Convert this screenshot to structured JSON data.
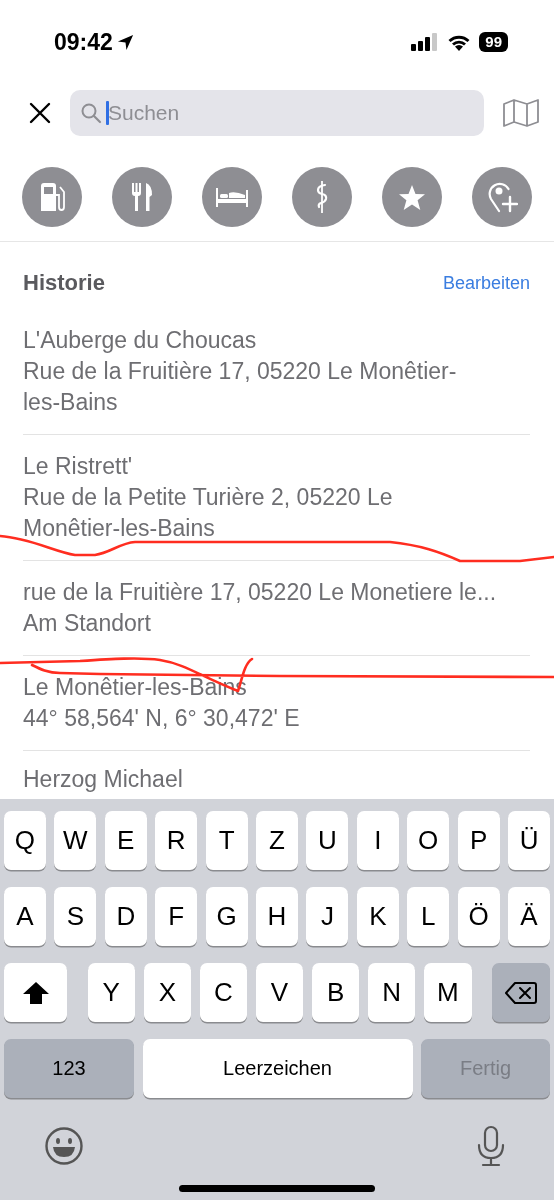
{
  "status_bar": {
    "time": "09:42",
    "battery": "99"
  },
  "search": {
    "placeholder": "Suchen",
    "focused": true
  },
  "categories": [
    {
      "kind": "fuel"
    },
    {
      "kind": "food"
    },
    {
      "kind": "hotel"
    },
    {
      "kind": "medical"
    },
    {
      "kind": "favorite"
    },
    {
      "kind": "add-place"
    }
  ],
  "history": {
    "title": "Historie",
    "edit": "Bearbeiten",
    "items": [
      {
        "title": "L'Auberge du Choucas",
        "subtitle": "Rue de la Fruitière 17, 05220 Le Monêtier-les-Bains"
      },
      {
        "title": "Le Ristrett'",
        "subtitle": "Rue de la Petite Turière 2, 05220 Le Monêtier-les-Bains"
      },
      {
        "title": "rue de la Fruitière 17, 05220 Le Monetiere le...",
        "subtitle": "Am Standort"
      },
      {
        "title": "Le Monêtier-les-Bains",
        "subtitle": "44° 58,564' N, 6° 30,472' E"
      },
      {
        "title": "Herzog Michael"
      }
    ]
  },
  "markup": [
    {
      "kind": "strike"
    },
    {
      "kind": "strike"
    }
  ],
  "keyboard": {
    "top_row": [
      "Q",
      "W",
      "E",
      "R",
      "T",
      "Z",
      "U",
      "I",
      "O",
      "P",
      "Ü"
    ],
    "middle_row": [
      "A",
      "S",
      "D",
      "F",
      "G",
      "H",
      "J",
      "K",
      "L",
      "Ö",
      "Ä"
    ],
    "bottom_row": [
      "Y",
      "X",
      "C",
      "V",
      "B",
      "N",
      "M"
    ],
    "numbers": "123",
    "space": "Leerzeichen",
    "done": "Fertig",
    "done_disabled": true
  }
}
